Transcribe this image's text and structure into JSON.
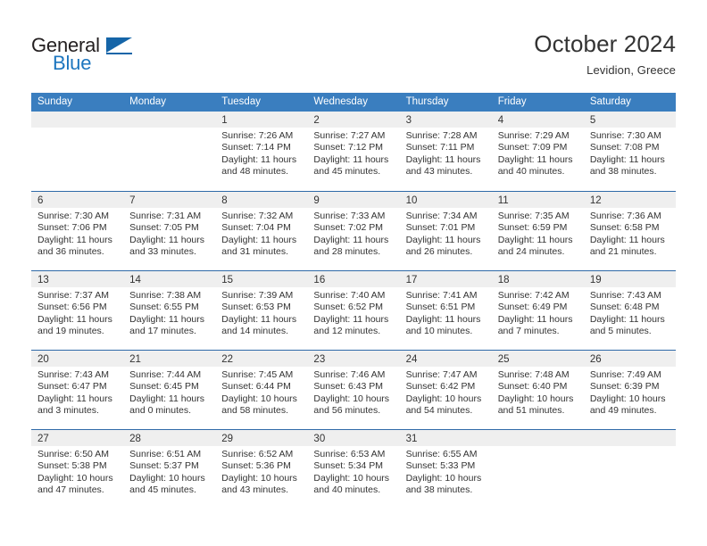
{
  "logo": {
    "word_one": "General",
    "word_two": "Blue",
    "color_dark": "#231f20",
    "color_blue": "#1d76bf"
  },
  "header": {
    "month_title": "October 2024",
    "location": "Levidion, Greece"
  },
  "theme": {
    "header_blue": "#3a7ebf",
    "row_border_blue": "#2f6aa8",
    "day_band_gray": "#efefef",
    "text": "#333333"
  },
  "weekdays": [
    "Sunday",
    "Monday",
    "Tuesday",
    "Wednesday",
    "Thursday",
    "Friday",
    "Saturday"
  ],
  "weeks": [
    [
      {
        "day": "",
        "empty": true
      },
      {
        "day": "",
        "empty": true
      },
      {
        "day": "1",
        "sunrise": "Sunrise: 7:26 AM",
        "sunset": "Sunset: 7:14 PM",
        "daylight_1": "Daylight: 11 hours",
        "daylight_2": "and 48 minutes."
      },
      {
        "day": "2",
        "sunrise": "Sunrise: 7:27 AM",
        "sunset": "Sunset: 7:12 PM",
        "daylight_1": "Daylight: 11 hours",
        "daylight_2": "and 45 minutes."
      },
      {
        "day": "3",
        "sunrise": "Sunrise: 7:28 AM",
        "sunset": "Sunset: 7:11 PM",
        "daylight_1": "Daylight: 11 hours",
        "daylight_2": "and 43 minutes."
      },
      {
        "day": "4",
        "sunrise": "Sunrise: 7:29 AM",
        "sunset": "Sunset: 7:09 PM",
        "daylight_1": "Daylight: 11 hours",
        "daylight_2": "and 40 minutes."
      },
      {
        "day": "5",
        "sunrise": "Sunrise: 7:30 AM",
        "sunset": "Sunset: 7:08 PM",
        "daylight_1": "Daylight: 11 hours",
        "daylight_2": "and 38 minutes."
      }
    ],
    [
      {
        "day": "6",
        "sunrise": "Sunrise: 7:30 AM",
        "sunset": "Sunset: 7:06 PM",
        "daylight_1": "Daylight: 11 hours",
        "daylight_2": "and 36 minutes."
      },
      {
        "day": "7",
        "sunrise": "Sunrise: 7:31 AM",
        "sunset": "Sunset: 7:05 PM",
        "daylight_1": "Daylight: 11 hours",
        "daylight_2": "and 33 minutes."
      },
      {
        "day": "8",
        "sunrise": "Sunrise: 7:32 AM",
        "sunset": "Sunset: 7:04 PM",
        "daylight_1": "Daylight: 11 hours",
        "daylight_2": "and 31 minutes."
      },
      {
        "day": "9",
        "sunrise": "Sunrise: 7:33 AM",
        "sunset": "Sunset: 7:02 PM",
        "daylight_1": "Daylight: 11 hours",
        "daylight_2": "and 28 minutes."
      },
      {
        "day": "10",
        "sunrise": "Sunrise: 7:34 AM",
        "sunset": "Sunset: 7:01 PM",
        "daylight_1": "Daylight: 11 hours",
        "daylight_2": "and 26 minutes."
      },
      {
        "day": "11",
        "sunrise": "Sunrise: 7:35 AM",
        "sunset": "Sunset: 6:59 PM",
        "daylight_1": "Daylight: 11 hours",
        "daylight_2": "and 24 minutes."
      },
      {
        "day": "12",
        "sunrise": "Sunrise: 7:36 AM",
        "sunset": "Sunset: 6:58 PM",
        "daylight_1": "Daylight: 11 hours",
        "daylight_2": "and 21 minutes."
      }
    ],
    [
      {
        "day": "13",
        "sunrise": "Sunrise: 7:37 AM",
        "sunset": "Sunset: 6:56 PM",
        "daylight_1": "Daylight: 11 hours",
        "daylight_2": "and 19 minutes."
      },
      {
        "day": "14",
        "sunrise": "Sunrise: 7:38 AM",
        "sunset": "Sunset: 6:55 PM",
        "daylight_1": "Daylight: 11 hours",
        "daylight_2": "and 17 minutes."
      },
      {
        "day": "15",
        "sunrise": "Sunrise: 7:39 AM",
        "sunset": "Sunset: 6:53 PM",
        "daylight_1": "Daylight: 11 hours",
        "daylight_2": "and 14 minutes."
      },
      {
        "day": "16",
        "sunrise": "Sunrise: 7:40 AM",
        "sunset": "Sunset: 6:52 PM",
        "daylight_1": "Daylight: 11 hours",
        "daylight_2": "and 12 minutes."
      },
      {
        "day": "17",
        "sunrise": "Sunrise: 7:41 AM",
        "sunset": "Sunset: 6:51 PM",
        "daylight_1": "Daylight: 11 hours",
        "daylight_2": "and 10 minutes."
      },
      {
        "day": "18",
        "sunrise": "Sunrise: 7:42 AM",
        "sunset": "Sunset: 6:49 PM",
        "daylight_1": "Daylight: 11 hours",
        "daylight_2": "and 7 minutes."
      },
      {
        "day": "19",
        "sunrise": "Sunrise: 7:43 AM",
        "sunset": "Sunset: 6:48 PM",
        "daylight_1": "Daylight: 11 hours",
        "daylight_2": "and 5 minutes."
      }
    ],
    [
      {
        "day": "20",
        "sunrise": "Sunrise: 7:43 AM",
        "sunset": "Sunset: 6:47 PM",
        "daylight_1": "Daylight: 11 hours",
        "daylight_2": "and 3 minutes."
      },
      {
        "day": "21",
        "sunrise": "Sunrise: 7:44 AM",
        "sunset": "Sunset: 6:45 PM",
        "daylight_1": "Daylight: 11 hours",
        "daylight_2": "and 0 minutes."
      },
      {
        "day": "22",
        "sunrise": "Sunrise: 7:45 AM",
        "sunset": "Sunset: 6:44 PM",
        "daylight_1": "Daylight: 10 hours",
        "daylight_2": "and 58 minutes."
      },
      {
        "day": "23",
        "sunrise": "Sunrise: 7:46 AM",
        "sunset": "Sunset: 6:43 PM",
        "daylight_1": "Daylight: 10 hours",
        "daylight_2": "and 56 minutes."
      },
      {
        "day": "24",
        "sunrise": "Sunrise: 7:47 AM",
        "sunset": "Sunset: 6:42 PM",
        "daylight_1": "Daylight: 10 hours",
        "daylight_2": "and 54 minutes."
      },
      {
        "day": "25",
        "sunrise": "Sunrise: 7:48 AM",
        "sunset": "Sunset: 6:40 PM",
        "daylight_1": "Daylight: 10 hours",
        "daylight_2": "and 51 minutes."
      },
      {
        "day": "26",
        "sunrise": "Sunrise: 7:49 AM",
        "sunset": "Sunset: 6:39 PM",
        "daylight_1": "Daylight: 10 hours",
        "daylight_2": "and 49 minutes."
      }
    ],
    [
      {
        "day": "27",
        "sunrise": "Sunrise: 6:50 AM",
        "sunset": "Sunset: 5:38 PM",
        "daylight_1": "Daylight: 10 hours",
        "daylight_2": "and 47 minutes."
      },
      {
        "day": "28",
        "sunrise": "Sunrise: 6:51 AM",
        "sunset": "Sunset: 5:37 PM",
        "daylight_1": "Daylight: 10 hours",
        "daylight_2": "and 45 minutes."
      },
      {
        "day": "29",
        "sunrise": "Sunrise: 6:52 AM",
        "sunset": "Sunset: 5:36 PM",
        "daylight_1": "Daylight: 10 hours",
        "daylight_2": "and 43 minutes."
      },
      {
        "day": "30",
        "sunrise": "Sunrise: 6:53 AM",
        "sunset": "Sunset: 5:34 PM",
        "daylight_1": "Daylight: 10 hours",
        "daylight_2": "and 40 minutes."
      },
      {
        "day": "31",
        "sunrise": "Sunrise: 6:55 AM",
        "sunset": "Sunset: 5:33 PM",
        "daylight_1": "Daylight: 10 hours",
        "daylight_2": "and 38 minutes."
      },
      {
        "day": "",
        "empty": true
      },
      {
        "day": "",
        "empty": true
      }
    ]
  ]
}
